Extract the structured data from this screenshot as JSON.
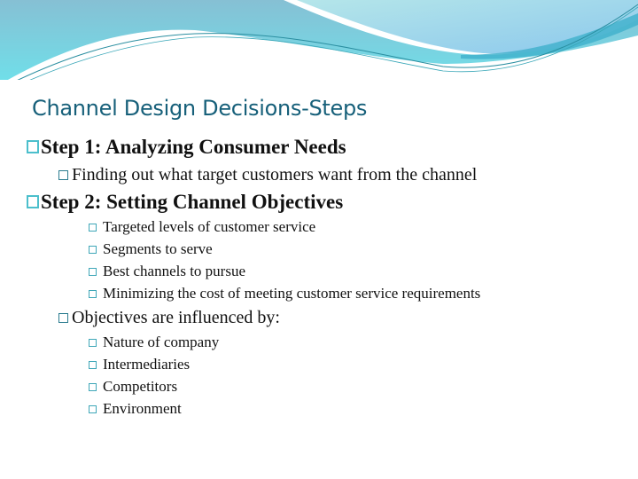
{
  "slide": {
    "title": "Channel Design Decisions-Steps",
    "step1": {
      "heading": "Step 1: Analyzing Consumer Needs",
      "items": [
        "Finding out what target customers want from the channel"
      ]
    },
    "step2": {
      "heading": "Step 2: Setting Channel Objectives",
      "items": [
        "Targeted levels of customer service",
        "Segments to serve",
        "Best channels to pursue",
        "Minimizing the cost of meeting customer service requirements"
      ],
      "influence": {
        "heading": "Objectives are influenced by:",
        "items": [
          "Nature of company",
          "Intermediaries",
          "Competitors",
          "Environment"
        ]
      }
    }
  },
  "colors": {
    "title": "#17607a",
    "bullet_level1": "#4cbfcc",
    "wave_light": "#7fd8e6",
    "wave_dark": "#2a8ea0"
  }
}
